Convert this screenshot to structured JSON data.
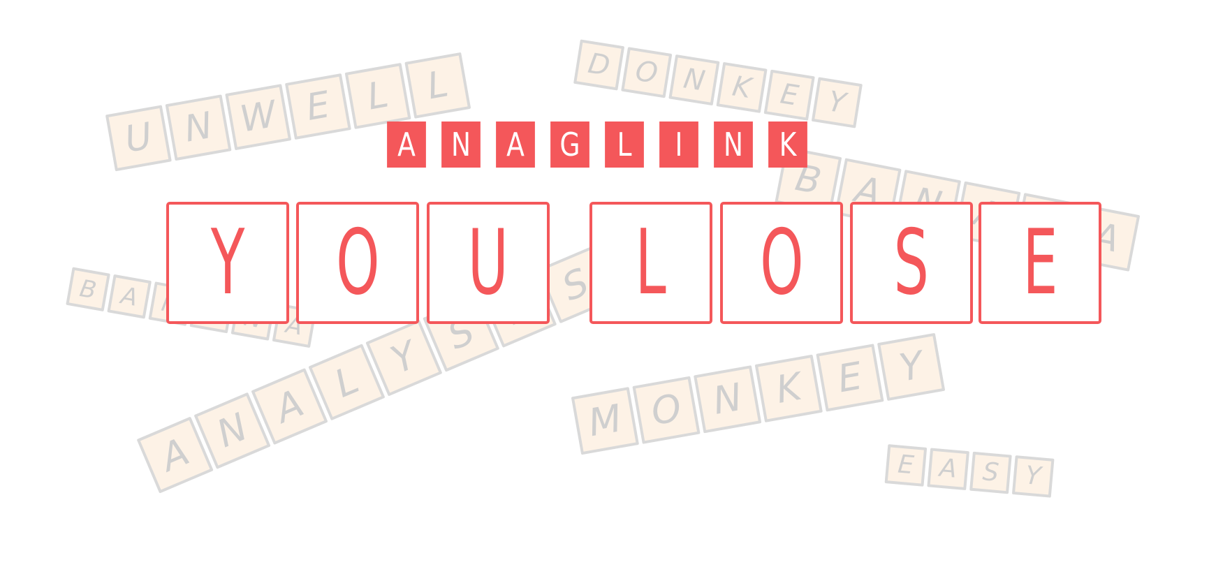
{
  "title": {
    "text": "ANAGLINK",
    "color": "#f4575a"
  },
  "result": {
    "words": [
      "YOU",
      "LOSE"
    ],
    "color": "#f4575a"
  },
  "background_words": [
    "UNWELL",
    "DONKEY",
    "BANANA",
    "BANANA",
    "ANALYSES",
    "MONKEY",
    "EASY"
  ],
  "colors": {
    "faded_tile_fill": "#fdf2e6",
    "faded_tile_border": "#d9d9d9",
    "faded_letter": "#cfcfcf",
    "background": "#ffffff"
  }
}
